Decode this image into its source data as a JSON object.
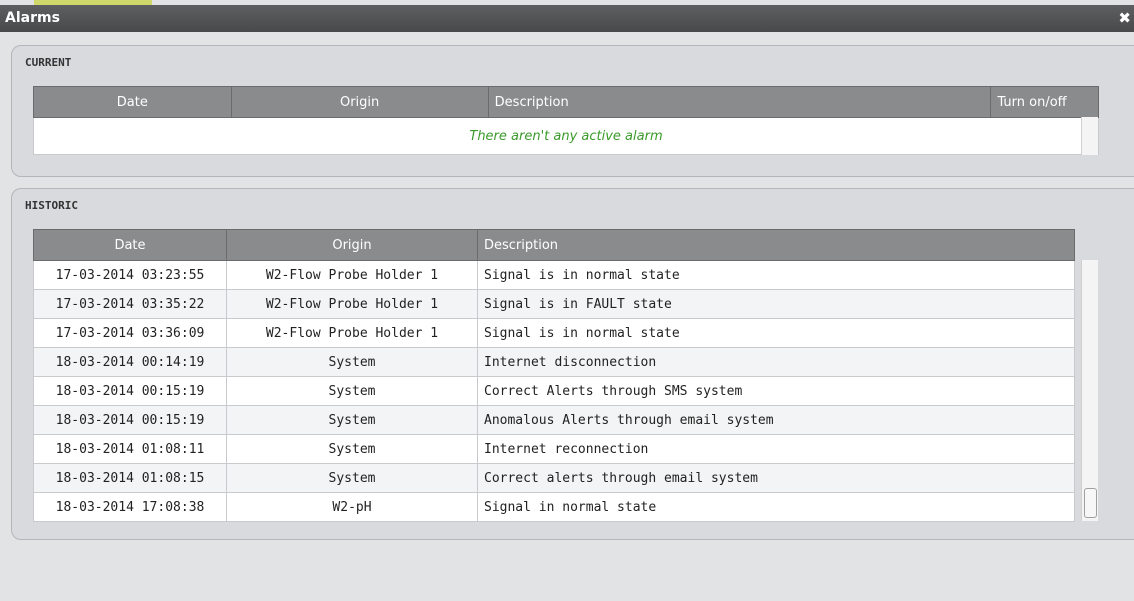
{
  "window": {
    "title": "Alarms",
    "close_icon": "close-icon"
  },
  "current": {
    "section_title": "CURRENT",
    "columns": [
      "Date",
      "Origin",
      "Description",
      "Turn on/off"
    ],
    "empty_message": "There aren't any active alarm"
  },
  "historic": {
    "section_title": "HISTORIC",
    "columns": [
      "Date",
      "Origin",
      "Description"
    ],
    "rows": [
      {
        "date": "17-03-2014 03:23:55",
        "origin": "W2-Flow Probe Holder 1",
        "description": "Signal is in normal state"
      },
      {
        "date": "17-03-2014 03:35:22",
        "origin": "W2-Flow Probe Holder 1",
        "description": "Signal is in FAULT state"
      },
      {
        "date": "17-03-2014 03:36:09",
        "origin": "W2-Flow Probe Holder 1",
        "description": "Signal is in normal state"
      },
      {
        "date": "18-03-2014 00:14:19",
        "origin": "System",
        "description": "Internet disconnection"
      },
      {
        "date": "18-03-2014 00:15:19",
        "origin": "System",
        "description": "Correct Alerts through SMS system"
      },
      {
        "date": "18-03-2014 00:15:19",
        "origin": "System",
        "description": "Anomalous Alerts through email system"
      },
      {
        "date": "18-03-2014 01:08:11",
        "origin": "System",
        "description": "Internet reconnection"
      },
      {
        "date": "18-03-2014 01:08:15",
        "origin": "System",
        "description": "Correct alerts through email system"
      },
      {
        "date": "18-03-2014 17:08:38",
        "origin": "W2-pH",
        "description": "Signal in normal state"
      }
    ]
  },
  "colors": {
    "titlebar": "#4f5052",
    "header": "#8a8b8d",
    "empty_message": "#3a9a2a"
  }
}
